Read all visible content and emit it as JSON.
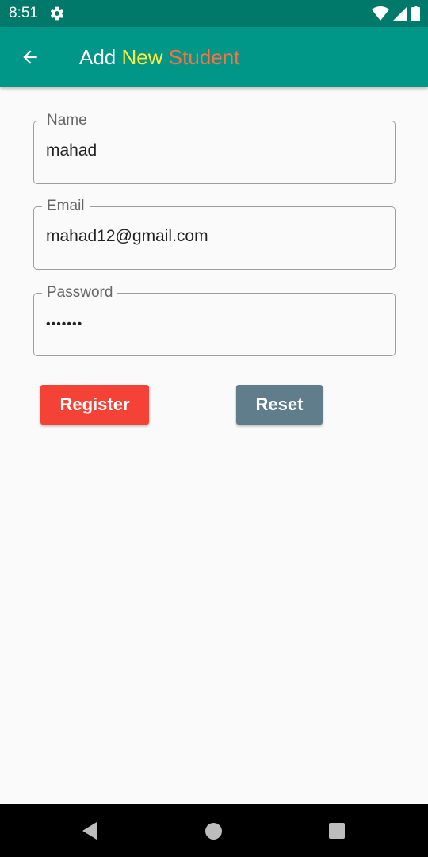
{
  "status_bar": {
    "time": "8:51",
    "icons": [
      "gear-icon",
      "wifi-icon",
      "cell-signal-icon",
      "battery-icon"
    ]
  },
  "app_bar": {
    "back_icon": "arrow-left-icon",
    "title_parts": [
      {
        "text": "Add",
        "color": "#ffffff"
      },
      {
        "text": "New",
        "color": "#ffeb3b"
      },
      {
        "text": "Student",
        "color": "#ff7043"
      }
    ]
  },
  "form": {
    "name": {
      "label": "Name",
      "value": "mahad"
    },
    "email": {
      "label": "Email",
      "value": "mahad12@gmail.com"
    },
    "password": {
      "label": "Password",
      "value": "•••••••"
    }
  },
  "buttons": {
    "register": {
      "label": "Register",
      "color": "#f44336"
    },
    "reset": {
      "label": "Reset",
      "color": "#607d8b"
    }
  },
  "nav_bar": {
    "icons": [
      "nav-back-icon",
      "nav-home-icon",
      "nav-recents-icon"
    ]
  }
}
